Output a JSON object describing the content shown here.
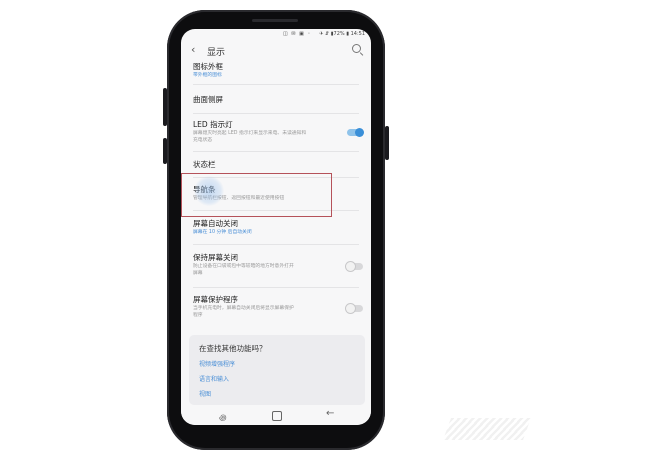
{
  "status_bar": {
    "left_icons": "◫ ✉ ▣ ◦",
    "right_text": "✈ ⇵ ▮72% ▮ 14:51"
  },
  "header": {
    "back_glyph": "‹",
    "title": "显示"
  },
  "settings": {
    "icon_frames": {
      "label": "图标外框",
      "sub": "带外框的图标"
    },
    "curved_edge": {
      "label": "曲面侧屏"
    },
    "led_indicator": {
      "label": "LED 指示灯",
      "sub1": "屏幕熄灭时亮起 LED 指示灯来显示来电、未读通知和",
      "sub2": "充电状态",
      "toggle_state": "on"
    },
    "status_bar_item": {
      "label": "状态栏"
    },
    "nav_bar": {
      "label": "导航条",
      "sub": "管理导航栏按钮、返回按钮和最近使用按钮"
    },
    "screen_timeout": {
      "label": "屏幕自动关闭",
      "sub": "屏幕在 10 分钟 后自动关闭"
    },
    "keep_screen_off": {
      "label": "保持屏幕关闭",
      "sub1": "防止设备在口袋或包中等较暗的地方时意外打开",
      "sub2": "屏幕",
      "toggle_state": "off"
    },
    "screensaver": {
      "label": "屏幕保护程序",
      "sub1": "当手机充电时，屏幕自动关闭后将显示屏幕保护",
      "sub2": "程序",
      "toggle_state": "off"
    }
  },
  "more": {
    "title": "在查找其他功能吗？",
    "links": [
      "视频增强程序",
      "语言和输入",
      "视图"
    ]
  },
  "nav": {
    "recent": "꩜",
    "back": "←"
  },
  "colors": {
    "accent": "#3a8fd8",
    "highlight_border": "#b5525a",
    "link": "#4a8fd6"
  }
}
